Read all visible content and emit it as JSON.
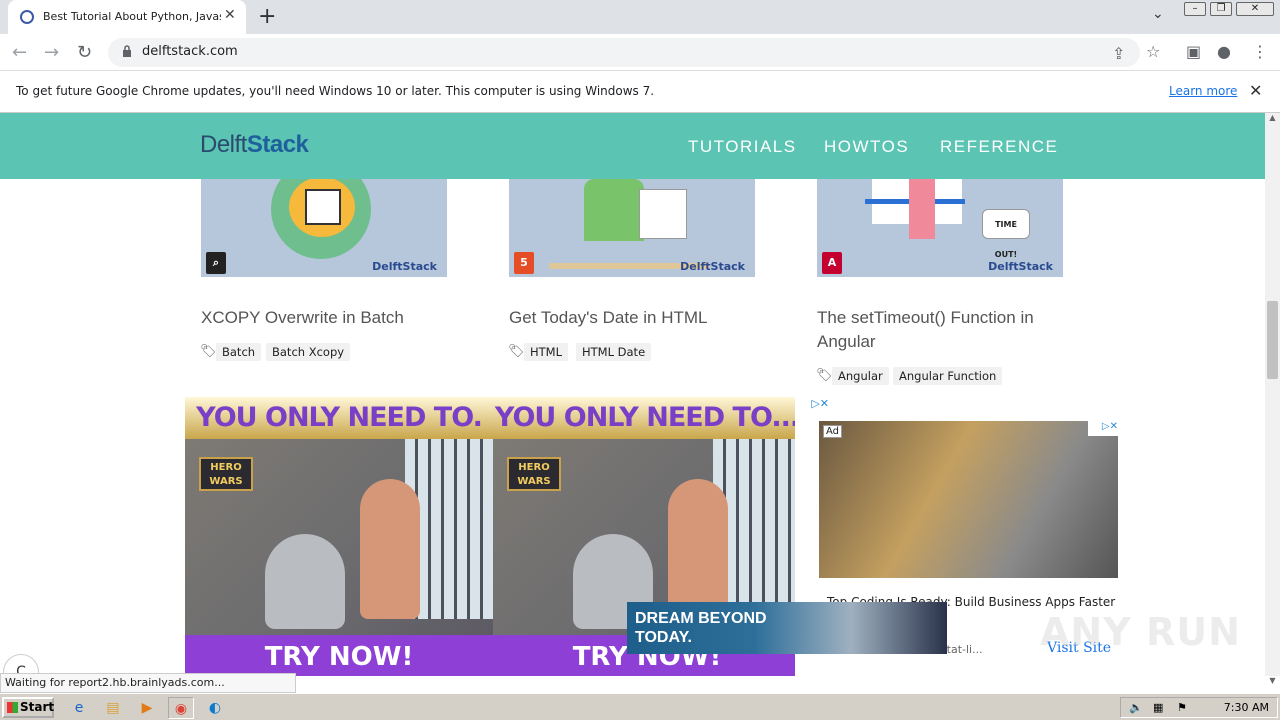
{
  "browser": {
    "tab_title": "Best Tutorial About Python, Javascript",
    "url": "delftstack.com",
    "infobar_message": "To get future Google Chrome updates, you'll need Windows 10 or later. This computer is using Windows 7.",
    "infobar_link": "Learn more",
    "status_text": "Waiting for report2.hb.brainlyads.com..."
  },
  "site": {
    "logo_plain": "Delft",
    "logo_bold": "Stack",
    "nav": [
      "TUTORIALS",
      "HOWTOS",
      "REFERENCE"
    ],
    "watermark": "DelftStack",
    "cards": [
      {
        "title": "XCOPY Overwrite in Batch",
        "tags": [
          "Batch",
          "Batch Xcopy"
        ]
      },
      {
        "title": "Get Today's Date in HTML",
        "tags": [
          "HTML",
          "HTML Date"
        ]
      },
      {
        "title": "The setTimeout() Function in Angular",
        "tags": [
          "Angular",
          "Angular Function"
        ]
      }
    ],
    "card3_image_text": "TIME OUT!"
  },
  "ads": {
    "game_headline": "YOU ONLY NEED TO.",
    "game_headline_2": "YOU ONLY NEED TO...",
    "game_logo": "HERO WARS",
    "game_cta": "TRY NOW!",
    "ad_label": "Ad",
    "native_headline": "Top Coding Is Ready: Build Business Apps Faster",
    "native_domain": "talent.com/resultat-li...",
    "native_cta": "Visit Site",
    "banner_text_1": "DREAM BEYOND",
    "banner_text_2": "TODAY.",
    "overlay_watermark": "ANY RUN"
  },
  "taskbar": {
    "start": "Start",
    "clock": "7:30 AM"
  }
}
